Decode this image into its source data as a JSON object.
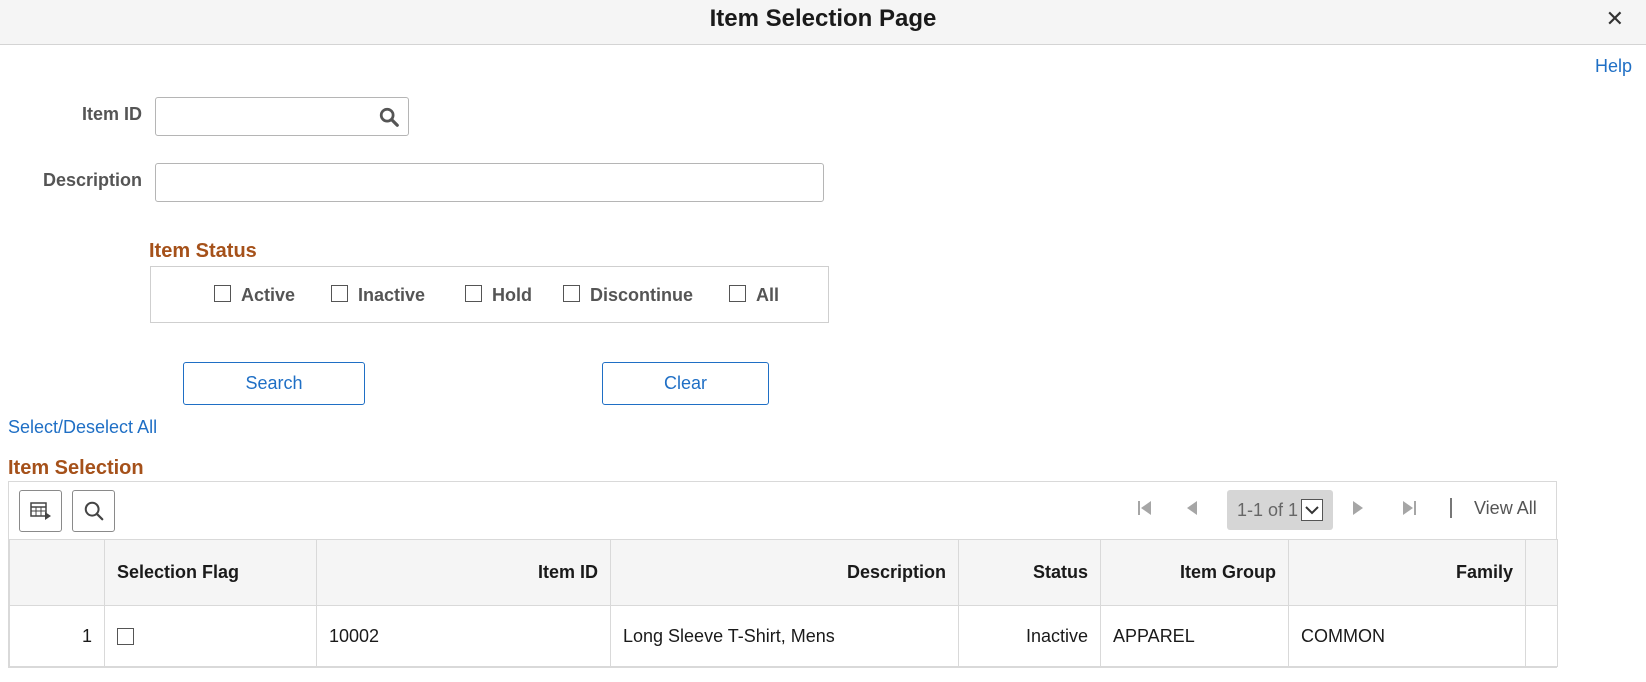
{
  "window": {
    "title": "Item Selection Page",
    "close_glyph": "✕",
    "help_label": "Help"
  },
  "form": {
    "item_id_label": "Item ID",
    "item_id_value": "",
    "description_label": "Description",
    "description_value": ""
  },
  "item_status": {
    "title": "Item Status",
    "options": [
      {
        "label": "Active",
        "checked": false
      },
      {
        "label": "Inactive",
        "checked": false
      },
      {
        "label": "Hold",
        "checked": false
      },
      {
        "label": "Discontinue",
        "checked": false
      },
      {
        "label": "All",
        "checked": false
      }
    ]
  },
  "buttons": {
    "search_label": "Search",
    "clear_label": "Clear"
  },
  "select_deselect_label": "Select/Deselect All",
  "grid": {
    "title": "Item Selection",
    "pager_text": "1-1 of 1",
    "view_all_label": "View All",
    "columns": [
      "",
      "Selection Flag",
      "Item ID",
      "Description",
      "Status",
      "Item Group",
      "Family"
    ],
    "rows": [
      {
        "row_num": "1",
        "selected": false,
        "item_id": "10002",
        "description": "Long Sleeve T-Shirt, Mens",
        "status": "Inactive",
        "item_group": "APPAREL",
        "family": "COMMON"
      }
    ]
  },
  "colors": {
    "accent_link": "#1f6fc5",
    "section_title": "#a5511a"
  }
}
